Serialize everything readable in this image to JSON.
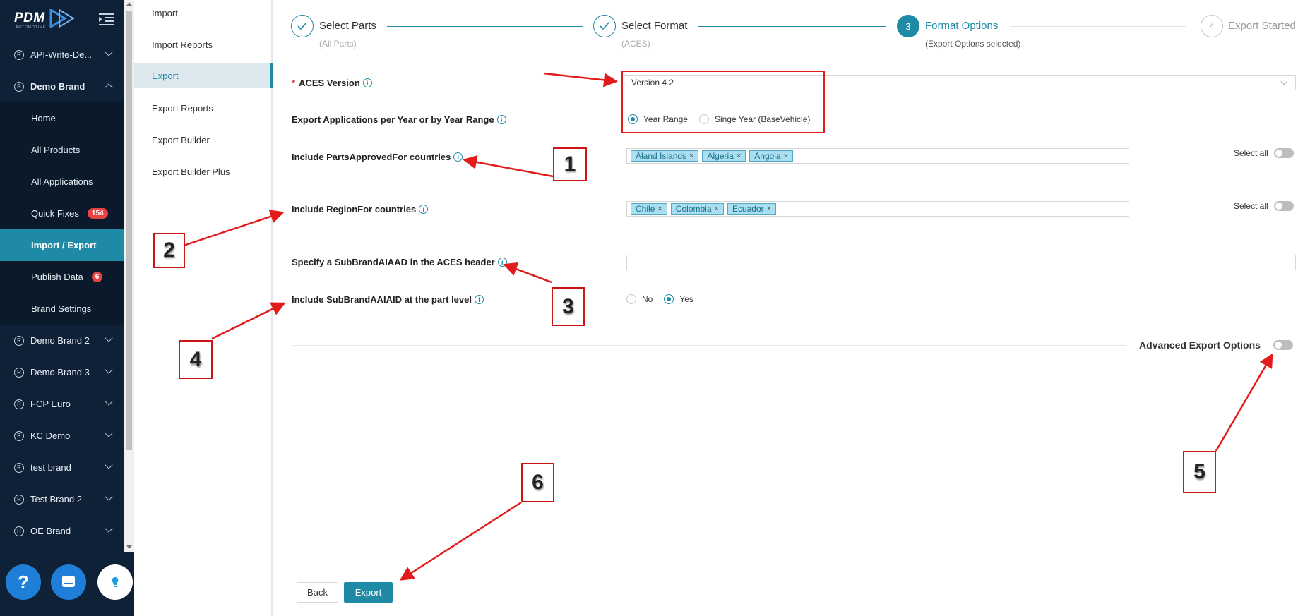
{
  "app": {
    "logo_text": "PDM",
    "logo_sub": "AUTOMOTIVE"
  },
  "sidebar": {
    "items": [
      {
        "label": "API-Write-De..."
      },
      {
        "label": "Demo Brand"
      },
      {
        "label": "Demo Brand 2"
      },
      {
        "label": "Demo Brand 3"
      },
      {
        "label": "FCP Euro"
      },
      {
        "label": "KC Demo"
      },
      {
        "label": "test brand"
      },
      {
        "label": "Test Brand 2"
      },
      {
        "label": "OE Brand"
      }
    ],
    "reg_symbol": "R",
    "sub_items": [
      {
        "label": "Home"
      },
      {
        "label": "All Products"
      },
      {
        "label": "All Applications"
      },
      {
        "label": "Quick Fixes",
        "badge": "154"
      },
      {
        "label": "Import / Export"
      },
      {
        "label": "Publish Data",
        "badge": "6"
      },
      {
        "label": "Brand Settings"
      }
    ],
    "help_label": "?"
  },
  "subnav": {
    "items": [
      {
        "label": "Import"
      },
      {
        "label": "Import Reports"
      },
      {
        "label": "Export"
      },
      {
        "label": "Export Reports"
      },
      {
        "label": "Export Builder"
      },
      {
        "label": "Export Builder Plus"
      }
    ]
  },
  "stepper": {
    "steps": [
      {
        "title": "Select Parts",
        "desc": "(All Parts)",
        "state": "done"
      },
      {
        "title": "Select Format",
        "desc": "(ACES)",
        "state": "done"
      },
      {
        "title": "Format Options",
        "desc": "(Export Options selected)",
        "state": "current",
        "number": "3"
      },
      {
        "title": "Export Started",
        "desc": "",
        "state": "future",
        "number": "4"
      }
    ]
  },
  "form": {
    "required_mark": "*",
    "aces_version_label": "ACES Version",
    "aces_version_value": "Version 4.2",
    "year_label": "Export Applications per Year or by Year Range",
    "year_options": [
      "Year Range",
      "Singe Year (BaseVehicle)"
    ],
    "parts_approved_label": "Include PartsApprovedFor countries",
    "parts_approved_tags": [
      "Åland Islands",
      "Algeria",
      "Angola"
    ],
    "region_label": "Include RegionFor countries",
    "region_tags": [
      "Chile",
      "Colombia",
      "Ecuador"
    ],
    "select_all_label": "Select all",
    "subbrand_header_label": "Specify a SubBrandAIAAD in the ACES header",
    "subbrand_part_label": "Include SubBrandAAIAID at the part level",
    "subbrand_part_options": [
      "No",
      "Yes"
    ],
    "advanced_label": "Advanced Export Options",
    "tag_remove": "×",
    "info_glyph": "i"
  },
  "buttons": {
    "back": "Back",
    "export": "Export"
  },
  "annotations": {
    "callouts": [
      "1",
      "2",
      "3",
      "4",
      "5",
      "6"
    ],
    "color": "#e21b1b"
  }
}
